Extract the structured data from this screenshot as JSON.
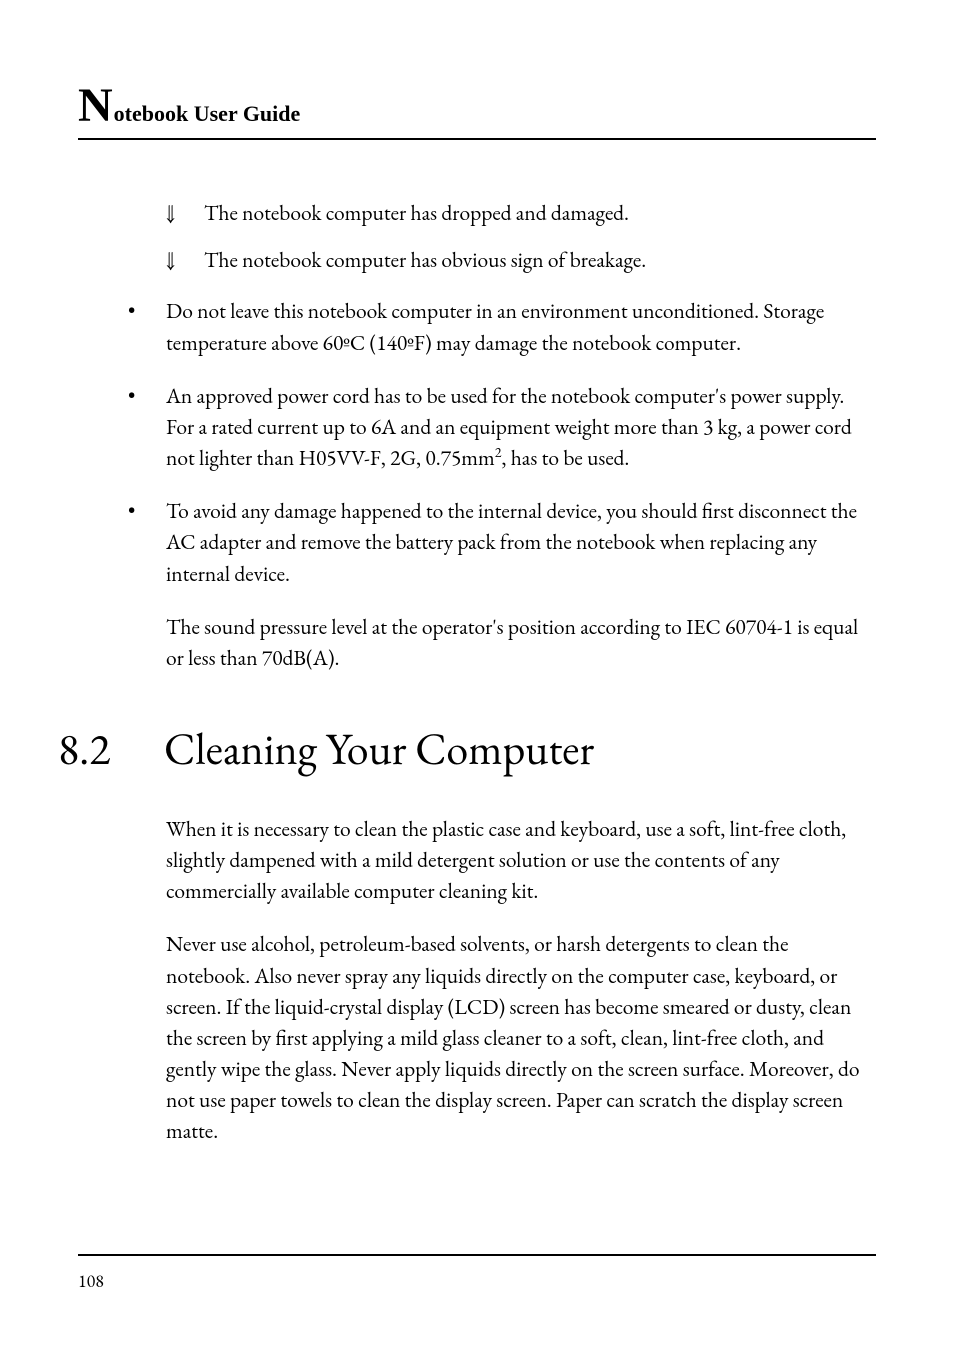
{
  "running_head": {
    "big_letter": "N",
    "rest": "otebook User Guide"
  },
  "arrow_items": [
    "The notebook computer has dropped and damaged.",
    "The notebook computer has obvious sign of breakage."
  ],
  "bullets": [
    {
      "text": "Do not leave this notebook computer in an environment unconditioned. Storage temperature above 60ºC (140ºF) may damage the notebook computer."
    },
    {
      "text_pre": "An approved power cord has to be used for the notebook computer's power supply.  For a rated current up to 6A and an equipment weight more than 3 kg, a power cord not lighter than H05VV-F, 2G, 0.75mm",
      "sup": "2",
      "text_post": ", has to be used."
    },
    {
      "text": "To avoid any damage happened to the internal device, you should first disconnect the AC adapter and remove the battery pack from the notebook when replacing any internal device."
    }
  ],
  "post_list_paragraph": "The sound pressure level at the operator's position according to IEC 60704-1 is equal or less than 70dB(A).",
  "section": {
    "number": "8.2",
    "title": "Cleaning Your Computer"
  },
  "body_paragraphs": [
    "When it is necessary to clean the plastic case and keyboard, use a soft, lint-free cloth, slightly dampened with a mild detergent solution or use the contents of any commercially available computer cleaning kit.",
    "Never use alcohol, petroleum-based solvents, or harsh detergents to clean the notebook. Also never spray any liquids directly on the computer case, keyboard, or screen. If the liquid-crystal display (LCD) screen has become smeared or dusty, clean the screen by first applying a mild glass cleaner to a soft, clean, lint-free cloth, and gently wipe the glass. Never apply liquids directly on the screen surface. Moreover, do not use paper towels to clean the display screen. Paper can scratch the display screen matte."
  ],
  "page_number": "108",
  "markers": {
    "double_down_arrow": "⇓",
    "bullet": "•"
  }
}
